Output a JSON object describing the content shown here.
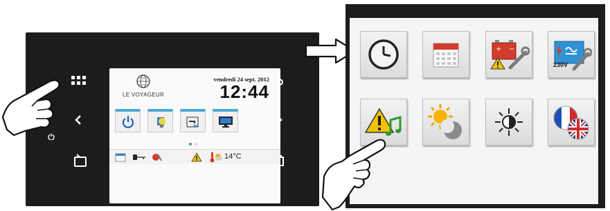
{
  "device": {
    "screen": {
      "logo_text": "LE VOYAGEUR",
      "date": "vendredi 24 sept. 2012",
      "time": "12:44",
      "status": {
        "temperature": "14°C"
      },
      "tiles": [
        "power-icon",
        "light-bulb-icon",
        "water-tap-icon",
        "tv-icon"
      ],
      "page_dots": 2,
      "active_page": 1
    },
    "buttons": {
      "menu": "grid-icon",
      "back": "return-arrow-icon",
      "left": "chevron-left-icon",
      "right": "chevron-right-icon",
      "power": "power-icon",
      "bottom_left": "water-tank-icon",
      "bottom_right": "battery-icon"
    }
  },
  "panel": {
    "tiles": [
      "clock-icon",
      "calendar-icon",
      "battery-maintenance-icon",
      "power-supply-230v-icon",
      "warning-sound-icon",
      "sun-moon-icon",
      "brightness-icon",
      "language-flags-icon"
    ],
    "labels": {
      "voltage": "230V"
    }
  },
  "colors": {
    "device_body": "#1c1b1d",
    "accent_blue": "#4fa9d6",
    "warning_yellow": "#f2c200"
  }
}
